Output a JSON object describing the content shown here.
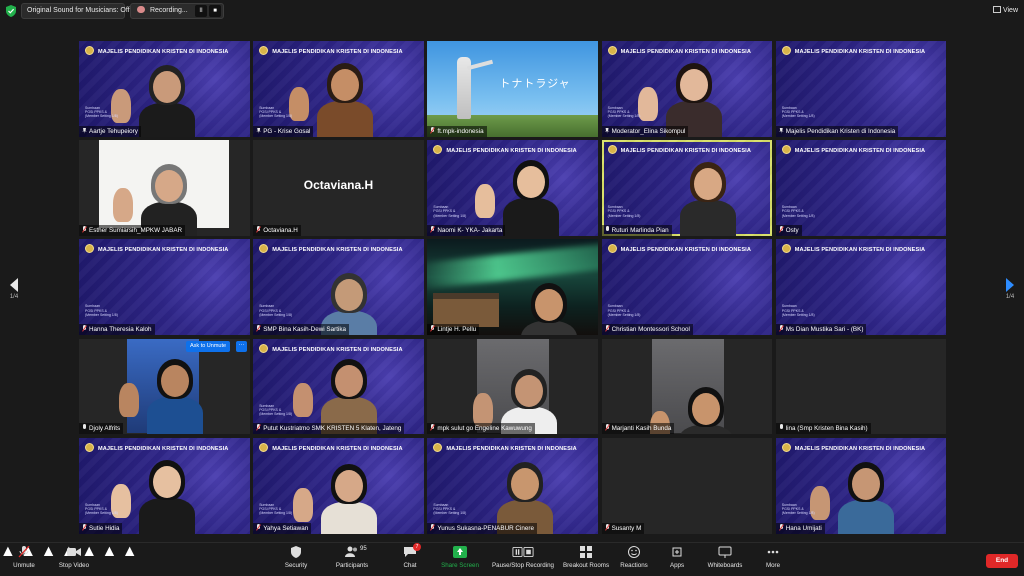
{
  "topbar": {
    "sound_label": "Original Sound for Musicians: Off",
    "recording_label": "Recording...",
    "pause_icon": "II",
    "stop_icon": "■",
    "view_label": "View"
  },
  "pager": {
    "left": "1/4",
    "right": "1/4"
  },
  "tile_banner": "MAJELIS PENDIDIKAN KRISTEN DI INDONESIA",
  "tile_mini": [
    "Sumbaan",
    "PGSI PPKS &",
    "(Member Setting 1/8)"
  ],
  "ask_to_unmute": "Ask to Unmute",
  "more_dots": "···",
  "special_tiles": {
    "octaviana_center": "Octaviana.H",
    "sky_text": "トナトラジャ"
  },
  "participants": [
    {
      "name": "Aartje Tehupeiory",
      "icon": "pin"
    },
    {
      "name": "PG - Krise Gosal",
      "icon": "pin"
    },
    {
      "name": "ft.mpk-indonesia",
      "icon": "mic-muted"
    },
    {
      "name": "Moderator_Elina Sikompul",
      "icon": "pin"
    },
    {
      "name": "Majelis Pendidikan Kristen di Indonesia",
      "icon": "pin"
    },
    {
      "name": "Esther Sumiarsih_MPKW JABAR",
      "icon": "mic-muted"
    },
    {
      "name": "Octaviana.H",
      "icon": "mic-muted"
    },
    {
      "name": "Naomi K- YKA- Jakarta",
      "icon": "mic-muted"
    },
    {
      "name": "Ruturi Marlinda Pian",
      "icon": "mic"
    },
    {
      "name": "Osty",
      "icon": "mic-muted"
    },
    {
      "name": "Hanna Theresia Kaloh",
      "icon": "mic-muted"
    },
    {
      "name": "SMP Bina Kasih-Dewi Sartika",
      "icon": "mic-muted"
    },
    {
      "name": "Lintje H. Pellu",
      "icon": "mic-muted"
    },
    {
      "name": "Christian Montessori School",
      "icon": "mic-muted"
    },
    {
      "name": "Ms Dian Mustika Sari - (BK)",
      "icon": "mic-muted"
    },
    {
      "name": "Djoly Alfrits",
      "icon": "mic"
    },
    {
      "name": "Putut Kustriatmo SMK KRISTEN 5 Klaten, Jateng",
      "icon": "mic-muted"
    },
    {
      "name": "mpk sulut go Engeline Kawuwung",
      "icon": "mic-muted"
    },
    {
      "name": "Marjanti Kasih Bunda",
      "icon": "mic-muted"
    },
    {
      "name": "lina (Smp Kristen Bina Kasih)",
      "icon": "mic"
    },
    {
      "name": "Sutie Hidia",
      "icon": "mic-muted"
    },
    {
      "name": "Yahya Setiawan",
      "icon": "mic-muted"
    },
    {
      "name": "Yunus Sukasna-PENABUR Cinere",
      "icon": "mic-muted"
    },
    {
      "name": "Susanty M",
      "icon": "mic-muted"
    },
    {
      "name": "Hana Umijati",
      "icon": "mic-muted"
    }
  ],
  "toolbar": {
    "unmute": "Unmute",
    "stop_video": "Stop Video",
    "security": "Security",
    "participants": "Participants",
    "participants_count": "95",
    "chat": "Chat",
    "chat_badge": "7",
    "share_screen": "Share Screen",
    "record": "Pause/Stop Recording",
    "breakout": "Breakout Rooms",
    "reactions": "Reactions",
    "apps": "Apps",
    "whiteboards": "Whiteboards",
    "more": "More",
    "end": "End"
  },
  "colors": {
    "share_green": "#22b14c",
    "end_red": "#e02828",
    "active_speaker": "#d9e069",
    "ask_blue": "#0e71eb"
  }
}
